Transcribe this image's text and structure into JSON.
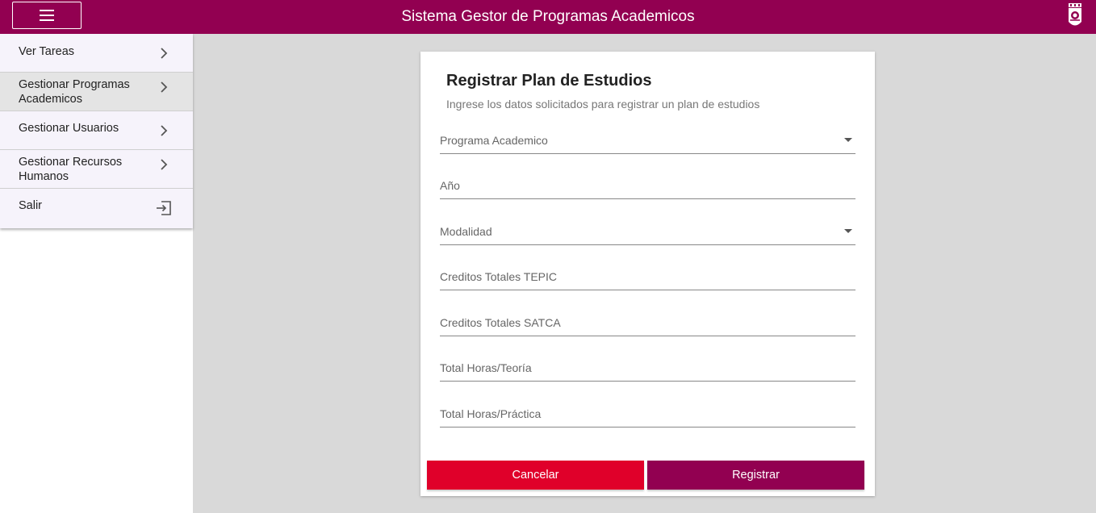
{
  "header": {
    "title": "Sistema Gestor de Programas Academicos",
    "menu_icon": "hamburger-icon",
    "logo_icon": "institution-logo",
    "bg_color": "#920051"
  },
  "sidebar": {
    "items": [
      {
        "label": "Ver Tareas",
        "icon": "chevron-right-icon"
      },
      {
        "label": "Gestionar Programas Academicos",
        "icon": "chevron-right-icon",
        "active": true
      },
      {
        "label": "Gestionar Usuarios",
        "icon": "chevron-right-icon"
      },
      {
        "label": "Gestionar Recursos Humanos",
        "icon": "chevron-right-icon"
      },
      {
        "label": "Salir",
        "icon": "exit-icon"
      }
    ]
  },
  "form": {
    "title": "Registrar Plan de Estudios",
    "subtitle": "Ingrese los datos solicitados para registrar un plan de estudios",
    "fields": [
      {
        "label": "Programa Academico",
        "type": "select",
        "value": ""
      },
      {
        "label": "Año",
        "type": "input",
        "value": ""
      },
      {
        "label": "Modalidad",
        "type": "select",
        "value": ""
      },
      {
        "label": "Creditos Totales TEPIC",
        "type": "input",
        "value": ""
      },
      {
        "label": "Creditos Totales SATCA",
        "type": "input",
        "value": ""
      },
      {
        "label": "Total Horas/Teoría",
        "type": "input",
        "value": ""
      },
      {
        "label": "Total Horas/Práctica",
        "type": "input",
        "value": ""
      }
    ],
    "cancel_label": "Cancelar",
    "submit_label": "Registrar",
    "cancel_color": "#e0002a",
    "submit_color": "#920051"
  }
}
